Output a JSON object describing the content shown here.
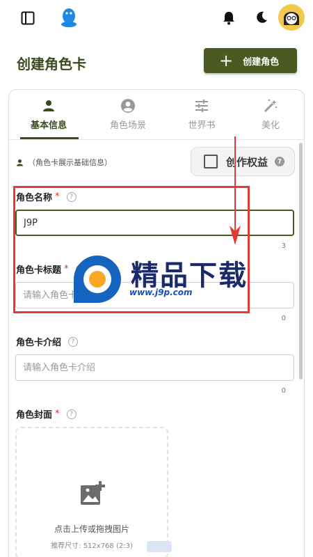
{
  "header": {
    "page_title": "创建角色卡",
    "create_button_label": "创建角色"
  },
  "tabs": [
    {
      "label": "基本信息",
      "icon": "person-icon",
      "active": true
    },
    {
      "label": "角色场景",
      "icon": "account-circle-icon",
      "active": false
    },
    {
      "label": "世界书",
      "icon": "tune-icon",
      "active": false
    },
    {
      "label": "美化",
      "icon": "magic-wand-icon",
      "active": false
    }
  ],
  "section": {
    "hint": "（角色卡展示基础信息）",
    "rights_label": "创作权益"
  },
  "fields": {
    "name": {
      "label": "角色名称",
      "required_mark": "*",
      "value": "J9P",
      "count": "3"
    },
    "title": {
      "label": "角色卡标题",
      "required_mark": "*",
      "placeholder": "请输入角色卡标题",
      "count": "0"
    },
    "intro": {
      "label": "角色卡介绍",
      "placeholder": "请输入角色卡介绍",
      "count": "0"
    },
    "cover": {
      "label": "角色封面",
      "required_mark": "*",
      "upload_text": "点击上传或拖拽图片",
      "size_hint": "推荐尺寸: 512x768 (2:3)"
    }
  },
  "watermark": {
    "text": "精品下载",
    "url": "www.j9p.com"
  },
  "colors": {
    "accent": "#4a5a22",
    "title": "#3a4a1e",
    "annotation": "#e53935",
    "required": "#d32f2f"
  }
}
